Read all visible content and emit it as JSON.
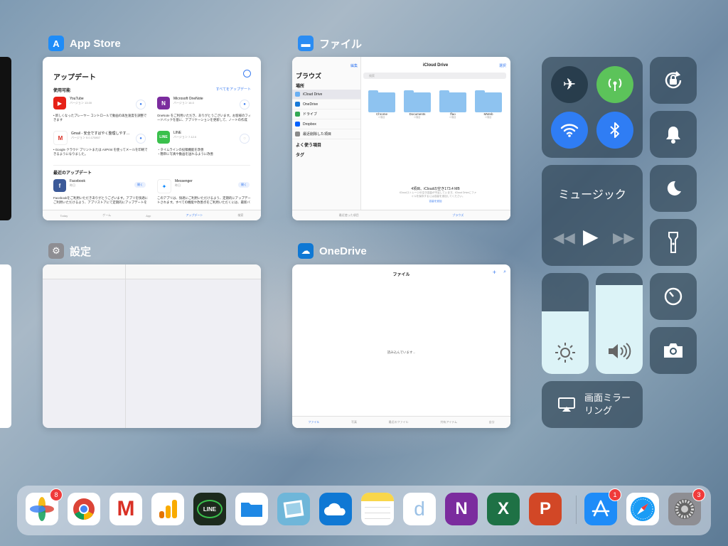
{
  "appstore": {
    "title": "App Store",
    "header": "アップデート",
    "available": "使用可能",
    "update_all": "すべてをアップデート",
    "items": [
      {
        "name": "YouTube",
        "sub": "バージョン 13.00",
        "desc": "• 新しくなったプレーヤー コントロールで動画の再生速度を調整できます"
      },
      {
        "name": "Microsoft OneNote",
        "sub": "バージョン 16.0",
        "desc": "OneNote をご利用いただき、ありがとうございます。お客様のフィードバックを基に、アプリケーションを更新して、ノートの作成"
      },
      {
        "name": "Gmail - 安全ですばやく整理しやす…",
        "sub": "バージョン 5.0.170807",
        "desc": "• Google クラウド プリントまたは AirPrint を使ってメールを印刷できるようになりました。"
      },
      {
        "name": "LINE",
        "sub": "バージョン 7.12.0",
        "desc": "・タイムラインの投稿機能を改善\n・簡単に写真や動画を送れるように改善"
      }
    ],
    "recent": "最近のアップデート",
    "recent_items": [
      {
        "name": "Facebook",
        "sub": "昨日",
        "open": "開く",
        "desc": "Facebookをご利用いただきありがとうございます。アプリを快適にご利用いただけるよう、アプリストアにて定期的にアップデートを"
      },
      {
        "name": "Messenger",
        "sub": "昨日",
        "open": "開く",
        "desc": "このアプリは、快適にご利用いただけるよう、定期的にアップデートされます。すべての機能や改善点をご利用いただくには、最新バ"
      }
    ],
    "tabs": [
      "Today",
      "ゲーム",
      "App",
      "アップデート",
      "検索"
    ]
  },
  "files": {
    "title": "ファイル",
    "edit": "編集",
    "select": "選択",
    "browse": "ブラウズ",
    "search_placeholder": "検索",
    "locations_header": "場所",
    "locations": [
      "iCloud Drive",
      "OneDrive",
      "ドライブ",
      "Dropbox",
      "最近削除した項目"
    ],
    "favorites": "よく使う項目",
    "tags": "タグ",
    "drive_title": "iCloud Drive",
    "folders": [
      {
        "name": "Chrome",
        "count": "0項目"
      },
      {
        "name": "Documents",
        "count": "0項目"
      },
      {
        "name": "ffao",
        "count": "0項目"
      },
      {
        "name": "MWeb",
        "count": "0項目"
      }
    ],
    "summary": "4項目、iCloudの空き173.4 MB",
    "note": "iCloudストレージの空き容量が不足しています。iCloud Driveにファイルを保存するには容量を追加してください。",
    "note_link": "容量を追加",
    "tab_recent": "最近使った項目",
    "tab_browse": "ブラウズ"
  },
  "settings": {
    "title": "設定"
  },
  "onedrive": {
    "title": "OneDrive",
    "header": "ファイル",
    "loading": "読み込んでいます...",
    "tabs": [
      "ファイル",
      "写真",
      "最近のファイル",
      "共有アイテム",
      "自分"
    ]
  },
  "control_center": {
    "music_title": "ミュージック",
    "mirroring": "画面ミラー\nリング",
    "brightness": 0.62,
    "volume": 0.88
  },
  "dock": [
    {
      "name": "photos-app",
      "badge": "8"
    },
    {
      "name": "chrome-app",
      "badge": ""
    },
    {
      "name": "gmail-app",
      "badge": ""
    },
    {
      "name": "analytics-app",
      "badge": ""
    },
    {
      "name": "line-app",
      "badge": "",
      "label": "LINE"
    },
    {
      "name": "files-app",
      "badge": ""
    },
    {
      "name": "preview-app",
      "badge": ""
    },
    {
      "name": "onedrive-app",
      "badge": ""
    },
    {
      "name": "notes-app",
      "badge": ""
    },
    {
      "name": "day-one-app",
      "badge": "",
      "label": "d"
    },
    {
      "name": "onenote-app",
      "badge": "",
      "label": "N"
    },
    {
      "name": "excel-app",
      "badge": "",
      "label": "X"
    },
    {
      "name": "powerpoint-app",
      "badge": "",
      "label": "P"
    },
    {
      "name": "appstore-app",
      "badge": "1"
    },
    {
      "name": "safari-app",
      "badge": ""
    },
    {
      "name": "settings-app",
      "badge": "3"
    }
  ]
}
